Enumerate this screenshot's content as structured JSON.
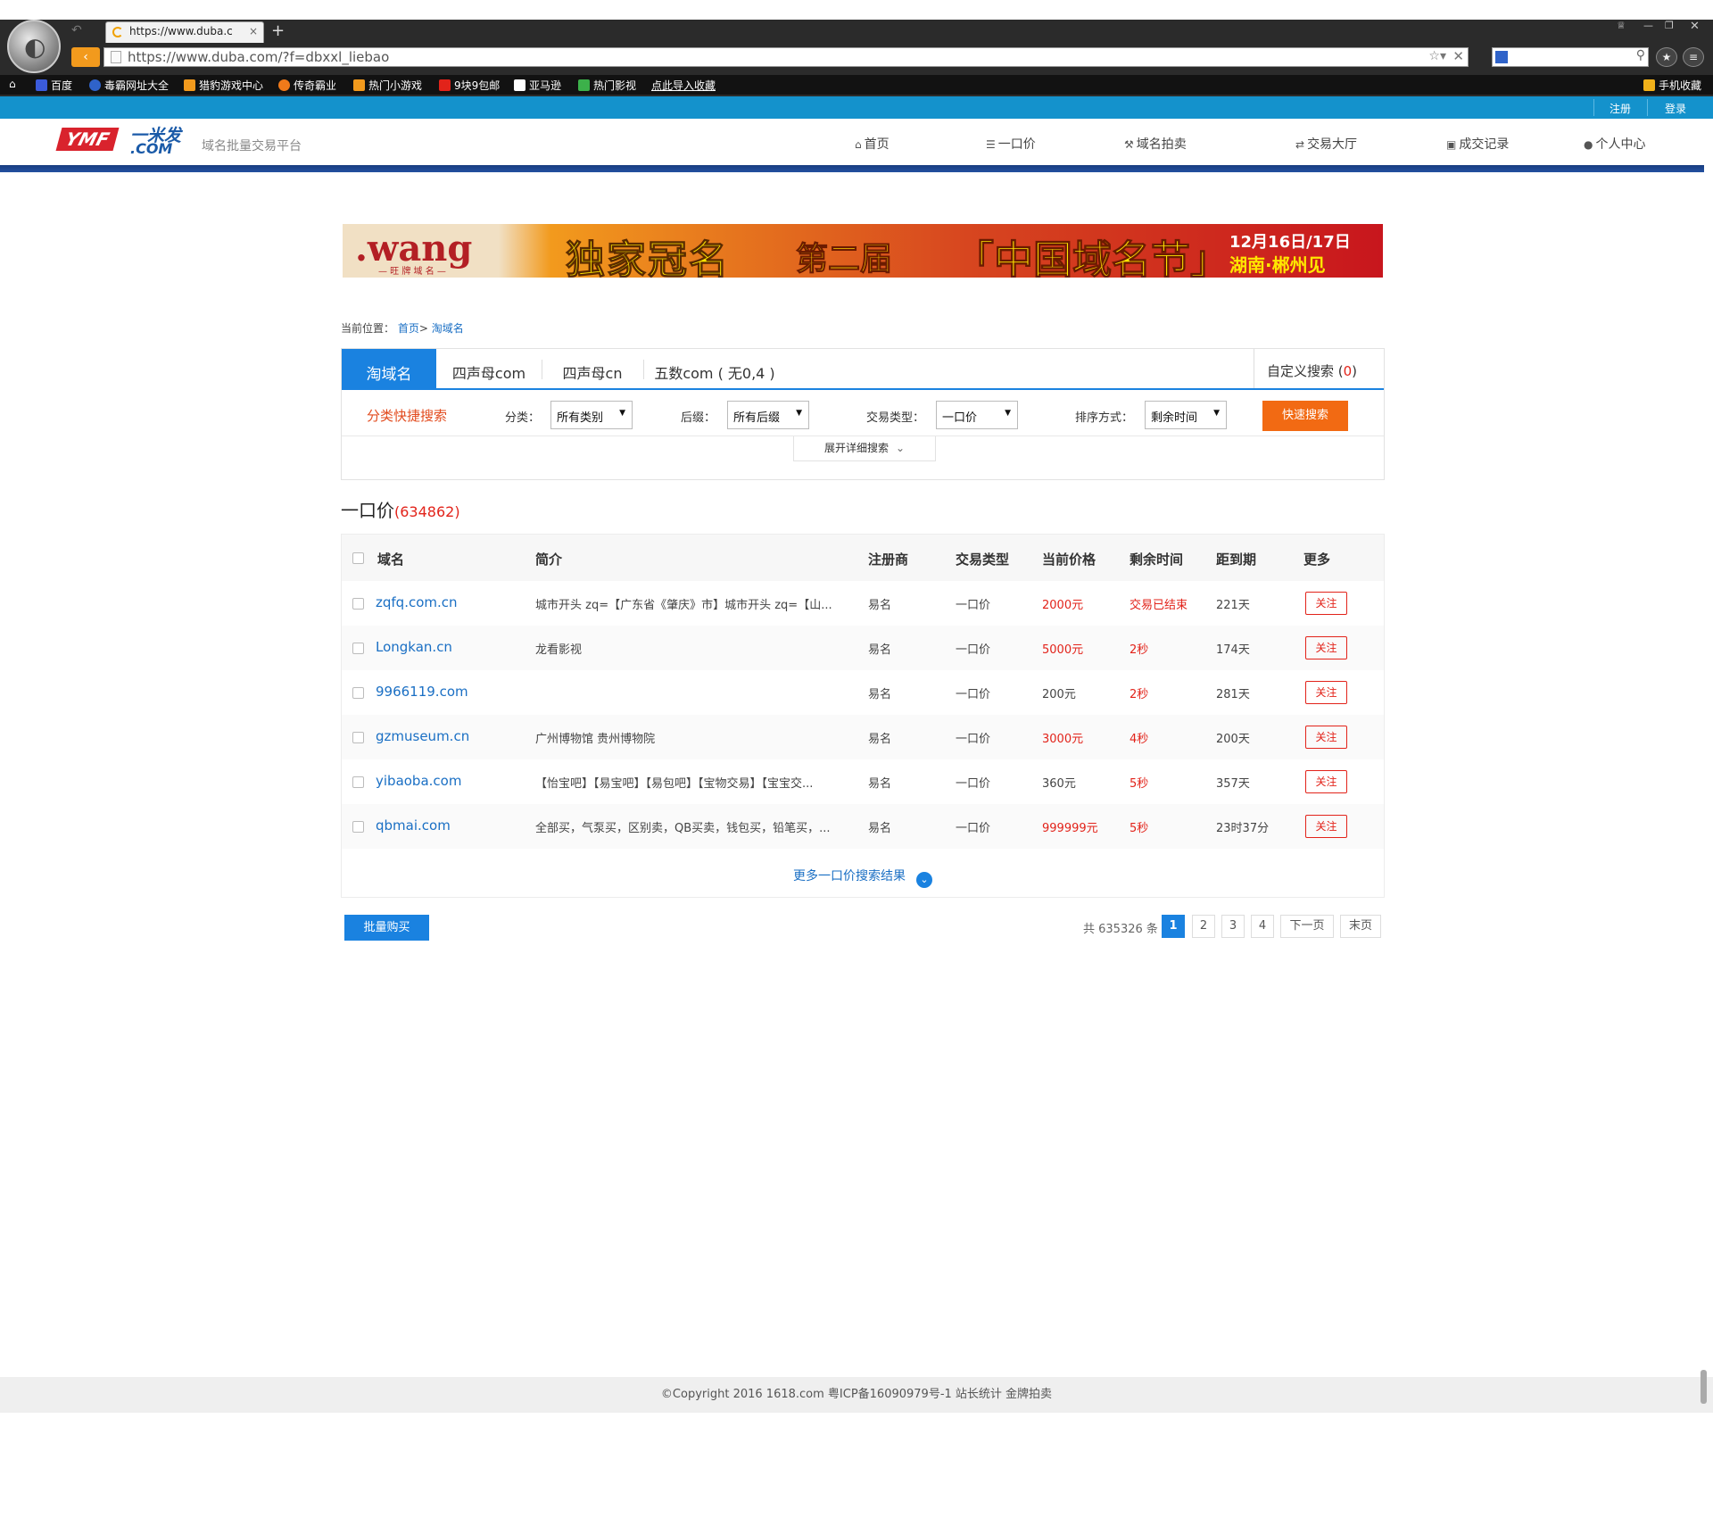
{
  "browser": {
    "tab_title": "https://www.duba.c",
    "tab_close": "×",
    "new_tab": "+",
    "url": "https://www.duba.com/?f=dbxxl_liebao",
    "favorites": [
      {
        "label": "百度",
        "icon": "baidu-icon",
        "color": "#3b5bdb"
      },
      {
        "label": "毒霸网址大全",
        "icon": "duba-k-icon",
        "color": "#2f63c9"
      },
      {
        "label": "猎豹游戏中心",
        "icon": "game-center-icon",
        "color": "#f29a1d"
      },
      {
        "label": "传奇霸业",
        "icon": "legend-icon",
        "color": "#f07a1a"
      },
      {
        "label": "热门小游戏",
        "icon": "mini-game-icon",
        "color": "#f29a1d"
      },
      {
        "label": "9块9包邮",
        "icon": "shop-icon",
        "color": "#e2231a"
      },
      {
        "label": "亚马逊",
        "icon": "amazon-icon",
        "color": "#ffffff"
      },
      {
        "label": "热门影视",
        "icon": "video-icon",
        "color": "#3cb14a"
      }
    ],
    "import_favorites": "点此导入收藏",
    "mobile_favorites": "手机收藏"
  },
  "site": {
    "register": "注册",
    "login": "登录",
    "logo_red": "YMF",
    "logo_blue": "一米发",
    "logo_com": ".COM",
    "tagline": "域名批量交易平台",
    "nav": [
      {
        "label": "首页",
        "icon": "home-icon",
        "glyph": "⌂"
      },
      {
        "label": "一口价",
        "icon": "list-icon",
        "glyph": "☰"
      },
      {
        "label": "域名拍卖",
        "icon": "gavel-icon",
        "glyph": "⚒"
      },
      {
        "label": "交易大厅",
        "icon": "exchange-icon",
        "glyph": "⇄"
      },
      {
        "label": "成交记录",
        "icon": "archive-icon",
        "glyph": "▣"
      },
      {
        "label": "个人中心",
        "icon": "user-icon",
        "glyph": "●"
      }
    ]
  },
  "banner": {
    "brand": ".wang",
    "brand_sub": "— 旺 牌 域 名 —",
    "text1": "独家冠名",
    "text2": "第二届",
    "text3": "「中国域名节」",
    "date": "12月16日/17日",
    "place": "湖南·郴州见"
  },
  "breadcrumb": {
    "prefix": "当前位置：",
    "home": "首页",
    "sep": ">",
    "current": "淘域名"
  },
  "search_tabs": [
    "淘域名",
    "四声母com",
    "四声母cn",
    "五数com ( 无0,4 )"
  ],
  "custom_search": {
    "label": "自定义搜索 (",
    "count": "0",
    "close": ")"
  },
  "filters": {
    "title": "分类快捷搜索",
    "category_label": "分类：",
    "category_value": "所有类别",
    "suffix_label": "后缀：",
    "suffix_value": "所有后缀",
    "type_label": "交易类型：",
    "type_value": "一口价",
    "sort_label": "排序方式：",
    "sort_value": "剩余时间",
    "quick_search": "快速搜索",
    "expand": "展开详细搜索"
  },
  "results": {
    "title": "一口价",
    "count": "(634862)"
  },
  "table": {
    "headers": [
      "域名",
      "简介",
      "注册商",
      "交易类型",
      "当前价格",
      "剩余时间",
      "距到期",
      "更多"
    ],
    "rows": [
      {
        "domain": "zqfq.com.cn",
        "desc": "城市开头 zq=【广东省《肇庆》市】城市开头 zq=【山...",
        "registrar": "易名",
        "type": "一口价",
        "price": "2000元",
        "price_red": true,
        "remaining": "交易已结束",
        "expiry": "221天",
        "action": "关注"
      },
      {
        "domain": "Longkan.cn",
        "desc": "龙看影视",
        "registrar": "易名",
        "type": "一口价",
        "price": "5000元",
        "price_red": true,
        "remaining": "2秒",
        "expiry": "174天",
        "action": "关注"
      },
      {
        "domain": "9966119.com",
        "desc": "",
        "registrar": "易名",
        "type": "一口价",
        "price": "200元",
        "price_red": false,
        "remaining": "2秒",
        "expiry": "281天",
        "action": "关注"
      },
      {
        "domain": "gzmuseum.cn",
        "desc": "广州博物馆 贵州博物院",
        "registrar": "易名",
        "type": "一口价",
        "price": "3000元",
        "price_red": true,
        "remaining": "4秒",
        "expiry": "200天",
        "action": "关注"
      },
      {
        "domain": "yibaoba.com",
        "desc": "【怡宝吧】【易宝吧】【易包吧】【宝物交易】【宝宝交...",
        "registrar": "易名",
        "type": "一口价",
        "price": "360元",
        "price_red": false,
        "remaining": "5秒",
        "expiry": "357天",
        "action": "关注"
      },
      {
        "domain": "qbmai.com",
        "desc": "全部买，气泵买，区别卖，QB买卖，钱包买，铅笔买，...",
        "registrar": "易名",
        "type": "一口价",
        "price": "999999元",
        "price_red": true,
        "remaining": "5秒",
        "expiry": "23时37分",
        "action": "关注"
      }
    ],
    "more": "更多一口价搜索结果"
  },
  "actions": {
    "batch_buy": "批量购买"
  },
  "pagination": {
    "total": "共 635326 条",
    "pages": [
      "1",
      "2",
      "3",
      "4"
    ],
    "next": "下一页",
    "last": "末页"
  },
  "footer": "©Copyright 2016 1618.com 粤ICP备16090979号-1 站长统计 金牌拍卖",
  "colors": {
    "accent": "#1a82e0",
    "red": "#e2231a",
    "orange": "#f26a13",
    "topbar": "#1492cc"
  }
}
